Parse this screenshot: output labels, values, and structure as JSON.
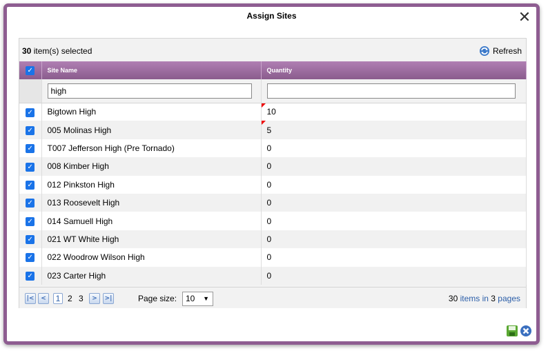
{
  "dialog": {
    "title": "Assign Sites",
    "close_symbol": "✕"
  },
  "toolbar": {
    "selected_count": "30",
    "selected_suffix": " item(s) selected",
    "refresh_label": "Refresh",
    "refresh_icon": "refresh-icon"
  },
  "columns": {
    "site_name": "Site Name",
    "quantity": "Quantity"
  },
  "filters": {
    "site_name_value": "high",
    "quantity_value": ""
  },
  "rows": [
    {
      "name": "Bigtown High",
      "qty": "10",
      "dirty": true
    },
    {
      "name": "005 Molinas High",
      "qty": "5",
      "dirty": true
    },
    {
      "name": "T007 Jefferson High (Pre Tornado)",
      "qty": "0",
      "dirty": false
    },
    {
      "name": "008 Kimber High",
      "qty": "0",
      "dirty": false
    },
    {
      "name": "012 Pinkston High",
      "qty": "0",
      "dirty": false
    },
    {
      "name": "013 Roosevelt High",
      "qty": "0",
      "dirty": false
    },
    {
      "name": "014 Samuell High",
      "qty": "0",
      "dirty": false
    },
    {
      "name": "021 WT White High",
      "qty": "0",
      "dirty": false
    },
    {
      "name": "022 Woodrow Wilson High",
      "qty": "0",
      "dirty": false
    },
    {
      "name": "023 Carter High",
      "qty": "0",
      "dirty": false
    }
  ],
  "pager": {
    "first_symbol": "K",
    "prev_symbol": "<",
    "next_symbol": ">",
    "last_symbol": ">|",
    "pages": [
      "1",
      "2",
      "3"
    ],
    "current_page": "1",
    "page_size_label": "Page size:",
    "page_size_value": "10",
    "info_count": "30",
    "info_items_in": " items in ",
    "info_pages_count": "3",
    "info_pages_word": " pages"
  },
  "footer": {
    "save_icon": "save-icon",
    "cancel_icon": "cancel-icon"
  },
  "colors": {
    "frame": "#8e5d91",
    "header_top": "#b07fb3",
    "header_bottom": "#8a5c8d",
    "checkbox": "#1a73e8",
    "dirty_flag": "#ee0000",
    "link": "#2b5ea8"
  }
}
